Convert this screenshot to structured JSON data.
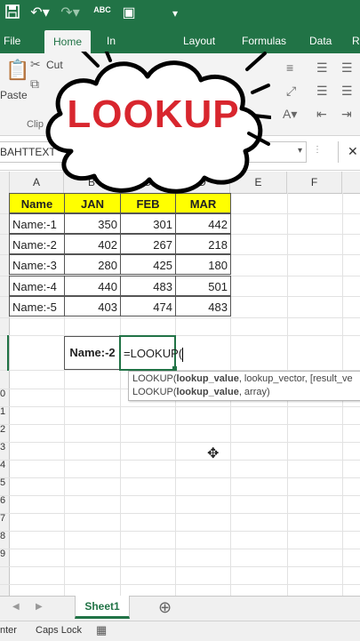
{
  "quick_access": {
    "save_icon": "save-icon",
    "undo_icon": "undo-icon",
    "redo_icon": "redo-icon",
    "spelling_label": "ABC",
    "camera_icon": "camera-icon"
  },
  "ribbon": {
    "tabs": [
      {
        "label": "File"
      },
      {
        "label": "Home"
      },
      {
        "label": "In"
      },
      {
        "label": "Layout"
      },
      {
        "label": "Formulas"
      },
      {
        "label": "Data"
      },
      {
        "label": "R"
      }
    ],
    "cut_label": "Cut",
    "paste_label": "Paste",
    "clipboard_label": "Clip"
  },
  "formula_bar": {
    "name_box": "BAHTTEXT",
    "cancel_symbol": "✕"
  },
  "columns": [
    "A",
    "B",
    "C",
    "D",
    "E",
    "F"
  ],
  "overlay": {
    "title": "LOOKUP"
  },
  "table": {
    "headers": [
      "Name",
      "JAN",
      "FEB",
      "MAR"
    ],
    "rows": [
      {
        "name": "Name:-1",
        "jan": "350",
        "feb": "301",
        "mar": "442"
      },
      {
        "name": "Name:-2",
        "jan": "402",
        "feb": "267",
        "mar": "218"
      },
      {
        "name": "Name:-3",
        "jan": "280",
        "feb": "425",
        "mar": "180"
      },
      {
        "name": "Name:-4",
        "jan": "440",
        "feb": "483",
        "mar": "501"
      },
      {
        "name": "Name:-5",
        "jan": "403",
        "feb": "474",
        "mar": "483"
      }
    ]
  },
  "lookup_input": {
    "label": "Name:-2",
    "formula": "=LOOKUP("
  },
  "tooltip": {
    "line1": {
      "fn": "LOOKUP(",
      "arg_bold": "lookup_value",
      "rest": ", lookup_vector, [result_ve"
    },
    "line2": {
      "fn": "LOOKUP(",
      "arg_bold": "lookup_value",
      "rest": ", array)"
    }
  },
  "row_numbers": [
    "0",
    "1",
    "2",
    "3",
    "4",
    "5",
    "6",
    "7",
    "8",
    "9"
  ],
  "sheets": {
    "active": "Sheet1",
    "add_symbol": "⊕"
  },
  "status": {
    "mode": "nter",
    "caps": "Caps Lock"
  }
}
